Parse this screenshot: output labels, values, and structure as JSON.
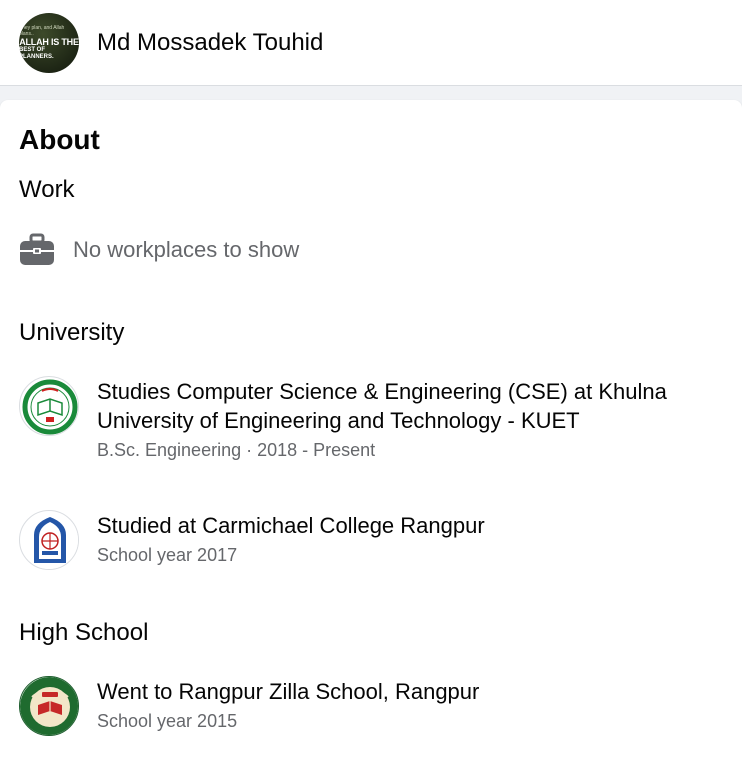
{
  "header": {
    "name": "Md Mossadek Touhid",
    "avatar_text": [
      "They plan, and Allah plans..",
      "ALLAH IS THE",
      "BEST OF PLANNERS."
    ]
  },
  "about": {
    "title": "About",
    "work": {
      "heading": "Work",
      "empty_text": "No workplaces to show",
      "icon": "briefcase-icon"
    },
    "university": {
      "heading": "University",
      "entries": [
        {
          "text": "Studies Computer Science & Engineering (CSE) at Khulna University of Engineering and Technology - KUET",
          "detail": "B.Sc. Engineering · 2018 - Present",
          "logo": "kuet-logo"
        },
        {
          "text": "Studied at Carmichael College Rangpur",
          "detail": "School year 2017",
          "logo": "carmichael-college-logo"
        }
      ]
    },
    "high_school": {
      "heading": "High School",
      "entries": [
        {
          "text": "Went to Rangpur Zilla School, Rangpur",
          "detail": "School year 2015",
          "logo": "rangpur-zilla-school-logo"
        }
      ]
    }
  },
  "colors": {
    "primary_text": "#050505",
    "secondary_text": "#65676b",
    "background": "#f0f2f5",
    "card": "#ffffff"
  }
}
